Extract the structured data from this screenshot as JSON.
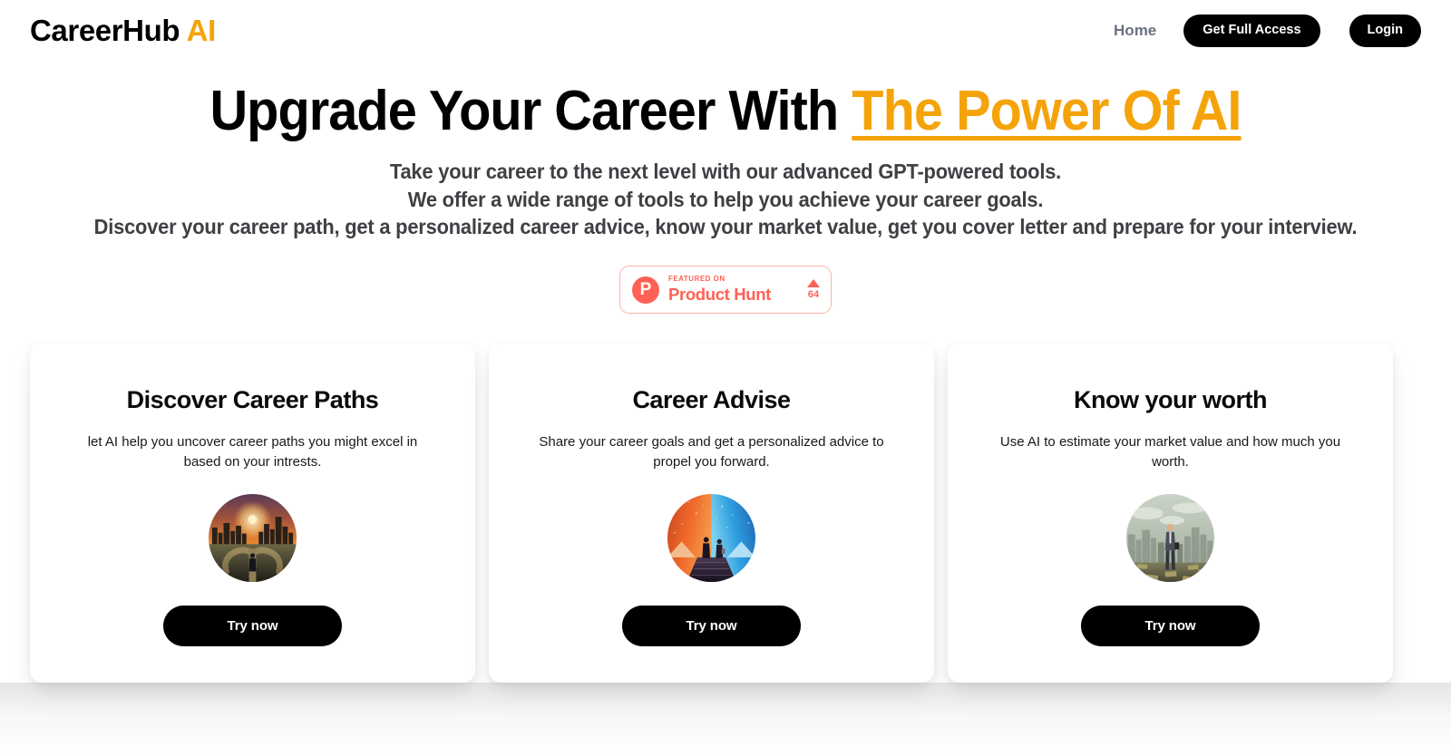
{
  "brand": {
    "name": "CareerHub",
    "suffix": "AI"
  },
  "nav": {
    "home_label": "Home",
    "get_access_label": "Get Full Access",
    "login_label": "Login"
  },
  "hero": {
    "headline_main": "Upgrade Your Career With ",
    "headline_accent": "The Power Of AI",
    "sub_line_1": "Take your career to the next level with our advanced GPT-powered tools.",
    "sub_line_2": "We offer a wide range of tools to help you achieve your career goals.",
    "sub_line_3": "Discover your career path, get a personalized career advice, know your market value, get you cover letter and prepare for your interview."
  },
  "product_hunt": {
    "logo_letter": "P",
    "featured_label": "FEATURED ON",
    "name": "Product Hunt",
    "upvotes": "64",
    "color": "#FF6154"
  },
  "cards": [
    {
      "title": "Discover Career Paths",
      "description": "let AI help you uncover career paths you might excel in based on your intrests.",
      "image_name": "career-crossroads-sunset-image",
      "cta": "Try now"
    },
    {
      "title": "Career Advise",
      "description": "Share your career goals and get a personalized advice to propel you forward.",
      "image_name": "two-figures-stairs-duotone-image",
      "cta": "Try now"
    },
    {
      "title": "Know your worth",
      "description": "Use AI to estimate your market value and how much you worth.",
      "image_name": "businessman-on-money-city-image",
      "cta": "Try now"
    }
  ],
  "colors": {
    "accent_orange": "#F5A30A",
    "product_hunt_coral": "#FF6154",
    "button_dark": "#000000",
    "subtitle_gray": "#3f4044",
    "nav_link_gray": "#6b7280"
  }
}
